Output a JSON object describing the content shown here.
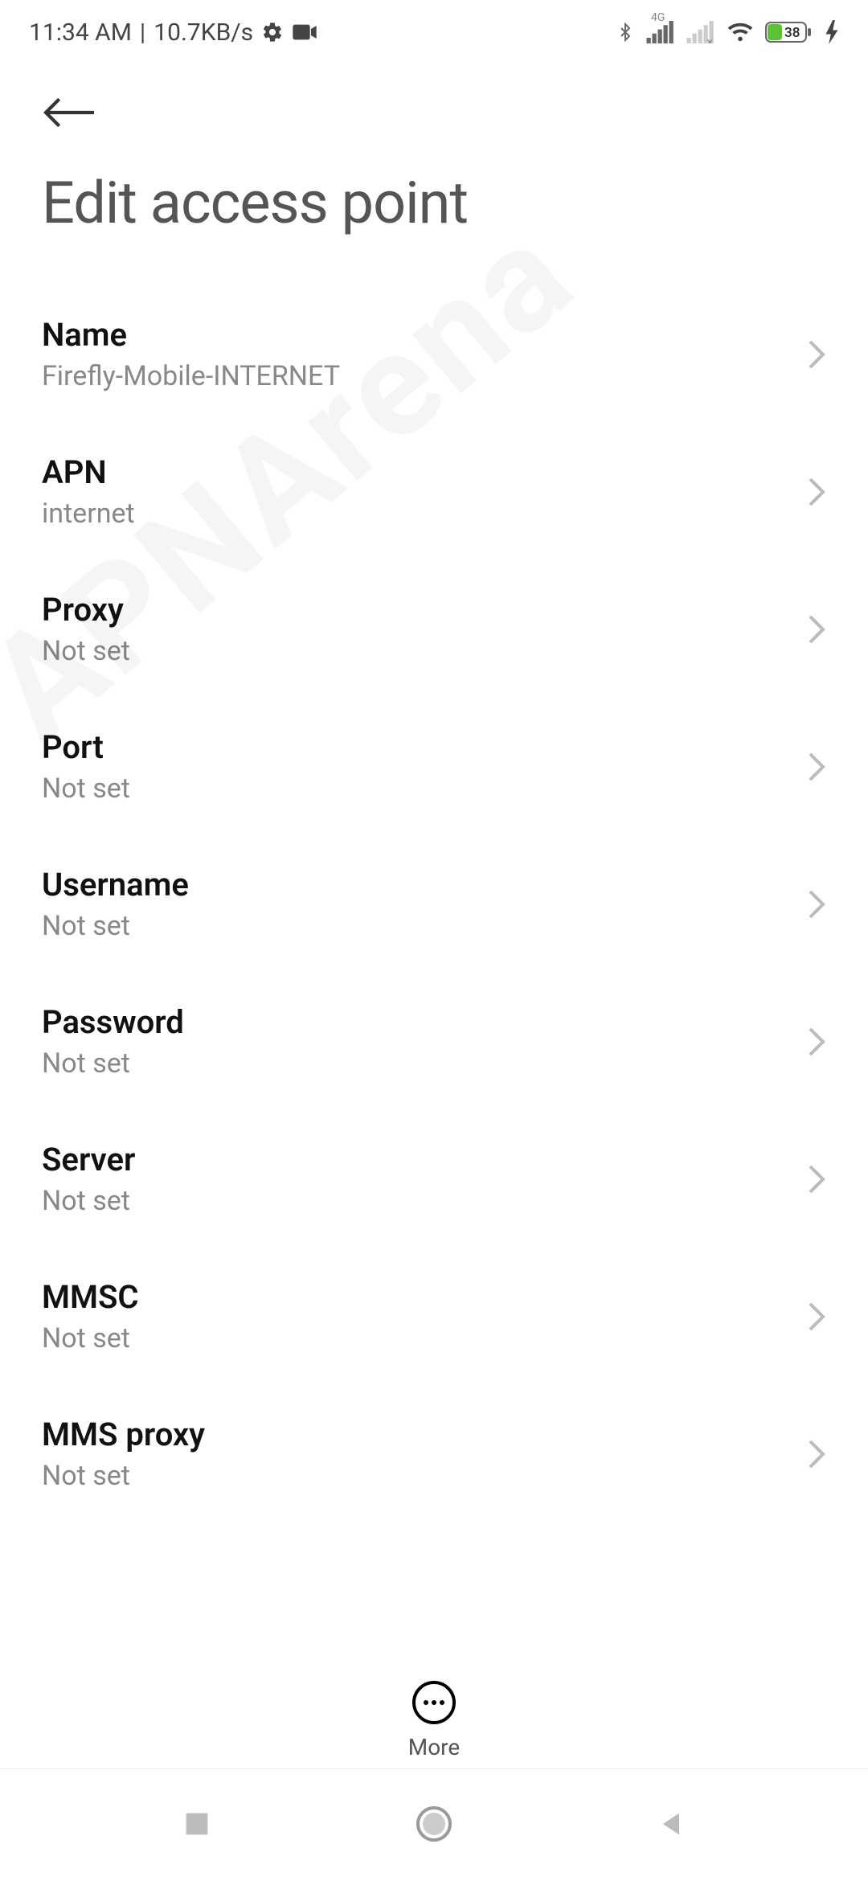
{
  "status": {
    "time": "11:34 AM",
    "speed": "10.7KB/s",
    "battery": "38",
    "network_label": "4G"
  },
  "page": {
    "title": "Edit access point"
  },
  "rows": [
    {
      "label": "Name",
      "value": "Firefly-Mobile-INTERNET"
    },
    {
      "label": "APN",
      "value": "internet"
    },
    {
      "label": "Proxy",
      "value": "Not set"
    },
    {
      "label": "Port",
      "value": "Not set"
    },
    {
      "label": "Username",
      "value": "Not set"
    },
    {
      "label": "Password",
      "value": "Not set"
    },
    {
      "label": "Server",
      "value": "Not set"
    },
    {
      "label": "MMSC",
      "value": "Not set"
    },
    {
      "label": "MMS proxy",
      "value": "Not set"
    }
  ],
  "bottom": {
    "more": "More"
  },
  "watermark": "APNArena"
}
